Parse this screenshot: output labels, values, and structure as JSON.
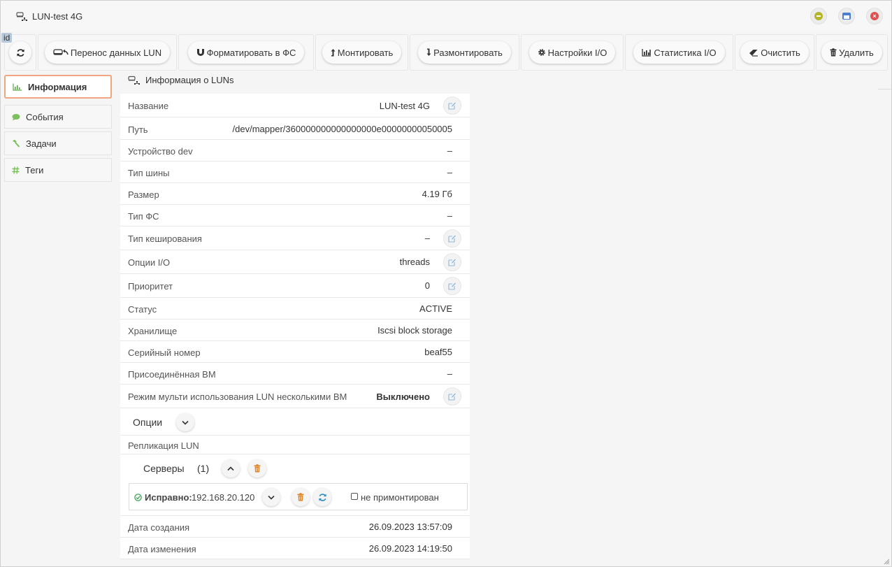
{
  "window": {
    "title": "LUN-test 4G",
    "id_badge": "id",
    "controls": [
      {
        "name": "minimize",
        "color": "#b5b52a"
      },
      {
        "name": "maximize",
        "color": "#4a7fd0"
      },
      {
        "name": "close",
        "color": "#e05050"
      }
    ]
  },
  "toolbar": {
    "refresh_icon": "refresh-icon",
    "buttons": [
      {
        "label": "Перенос данных LUN",
        "icon": "transfer-icon"
      },
      {
        "label": "Форматировать в ФС",
        "icon": "magnet-icon"
      },
      {
        "label": "Монтировать",
        "icon": "mount-arrow-icon"
      },
      {
        "label": "Размонтировать",
        "icon": "unmount-arrow-icon"
      },
      {
        "label": "Настройки I/O",
        "icon": "gear-icon"
      },
      {
        "label": "Статистика I/O",
        "icon": "bar-chart-icon"
      },
      {
        "label": "Очистить",
        "icon": "eraser-icon"
      },
      {
        "label": "Удалить",
        "icon": "trash-icon"
      }
    ]
  },
  "sidebar": {
    "items": [
      {
        "label": "Информация",
        "icon": "chart-icon",
        "active": true
      },
      {
        "label": "События",
        "icon": "comment-icon",
        "active": false
      },
      {
        "label": "Задачи",
        "icon": "hammer-icon",
        "active": false
      },
      {
        "label": "Теги",
        "icon": "hash-icon",
        "active": false
      }
    ]
  },
  "main": {
    "header": "Информация о LUNs",
    "rows": [
      {
        "label": "Название",
        "value": "LUN-test 4G",
        "editable": true
      },
      {
        "label": "Путь",
        "value": "/dev/mapper/360000000000000000e00000000050005",
        "editable": false
      },
      {
        "label": "Устройство dev",
        "value": "–",
        "editable": false
      },
      {
        "label": "Тип шины",
        "value": "–",
        "editable": false
      },
      {
        "label": "Размер",
        "value": "4.19 Гб",
        "editable": false
      },
      {
        "label": "Тип ФС",
        "value": "–",
        "editable": false
      },
      {
        "label": "Тип кеширования",
        "value": "–",
        "editable": true
      },
      {
        "label": "Опции I/O",
        "value": "threads",
        "editable": true
      },
      {
        "label": "Приоритет",
        "value": "0",
        "editable": true
      },
      {
        "label": "Статус",
        "value": "ACTIVE",
        "editable": false
      },
      {
        "label": "Хранилище",
        "value": "Iscsi block storage",
        "editable": false
      },
      {
        "label": "Серийный номер",
        "value": "beaf55",
        "editable": false
      },
      {
        "label": "Присоединённая ВМ",
        "value": "–",
        "editable": false
      },
      {
        "label": "Режим мульти использования LUN несколькими ВМ",
        "value": "Выключено",
        "editable": true
      }
    ],
    "options_label": "Опции",
    "replication_label": "Репликация LUN",
    "servers": {
      "label": "Серверы",
      "count": "(1)",
      "entry": {
        "status": "Исправно:",
        "address": "192.168.20.120",
        "mount_status": "не примонтирован",
        "mount_checked": false
      }
    },
    "created_label": "Дата создания",
    "created_value": "26.09.2023 13:57:09",
    "modified_label": "Дата изменения",
    "modified_value": "26.09.2023 14:19:50"
  },
  "colors": {
    "active_border": "#f0a47f",
    "ok_green": "#3aa655",
    "trash_orange": "#e0852a",
    "sync_blue": "#2a8abf",
    "edit_blue": "#8fb8d8"
  }
}
